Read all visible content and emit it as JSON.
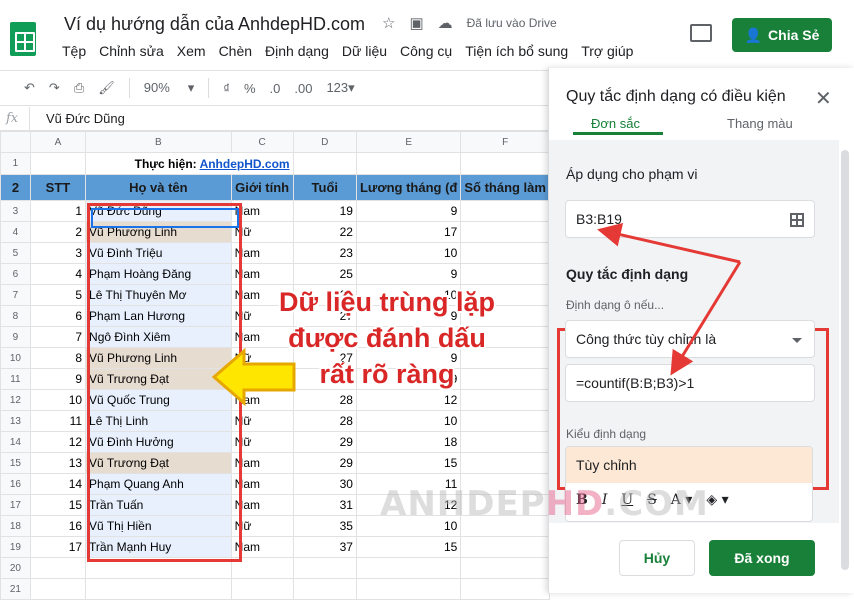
{
  "app": {
    "doc_title": "Ví dụ hướng dẫn của AnhdepHD.com",
    "saved_status": "Đã lưu vào Drive",
    "share_label": "Chia Sẻ",
    "menu": [
      "Tệp",
      "Chỉnh sửa",
      "Xem",
      "Chèn",
      "Định dạng",
      "Dữ liệu",
      "Công cụ",
      "Tiện ích bổ sung",
      "Trợ giúp"
    ]
  },
  "toolbar": {
    "zoom": "90%",
    "currency": "₫",
    "percent": "%",
    "decrease_decimal": ".0",
    "increase_decimal": ".00",
    "more_formats": "123"
  },
  "formula_bar": {
    "fx": "fx",
    "value": "Vũ Đức Dũng"
  },
  "sheet": {
    "col_headers": [
      "A",
      "B",
      "C",
      "D",
      "E",
      "F"
    ],
    "performed_by_label": "Thực hiện:",
    "performed_by_link": "AnhdepHD.com",
    "headers": [
      "STT",
      "Họ và tên",
      "Giới tính",
      "Tuổi",
      "Lương tháng (đ",
      "Số tháng làm"
    ],
    "rows": [
      {
        "row": "3",
        "stt": "1",
        "name": "Vũ Đức Dũng",
        "gender": "Nam",
        "age": "19",
        "salary": "9"
      },
      {
        "row": "4",
        "stt": "2",
        "name": "Vũ Phương Linh",
        "gender": "Nữ",
        "age": "22",
        "salary": "17"
      },
      {
        "row": "5",
        "stt": "3",
        "name": "Vũ Đình Triệu",
        "gender": "Nam",
        "age": "23",
        "salary": "10"
      },
      {
        "row": "6",
        "stt": "4",
        "name": "Phạm Hoàng Đăng",
        "gender": "Nam",
        "age": "25",
        "salary": "9"
      },
      {
        "row": "7",
        "stt": "5",
        "name": "Lê Thị Thuyên Mơ",
        "gender": "Nam",
        "age": "26",
        "salary": "10"
      },
      {
        "row": "8",
        "stt": "6",
        "name": "Phạm Lan Hương",
        "gender": "Nữ",
        "age": "27",
        "salary": "9"
      },
      {
        "row": "9",
        "stt": "7",
        "name": "Ngô Đình Xiêm",
        "gender": "Nam",
        "age": "27",
        "salary": "9"
      },
      {
        "row": "10",
        "stt": "8",
        "name": "Vũ Phương Linh",
        "gender": "Nữ",
        "age": "27",
        "salary": "9"
      },
      {
        "row": "11",
        "stt": "9",
        "name": "Vũ Trương Đạt",
        "gender": "Nam",
        "age": "27",
        "salary": "9"
      },
      {
        "row": "12",
        "stt": "10",
        "name": "Vũ Quốc Trung",
        "gender": "Nam",
        "age": "28",
        "salary": "12"
      },
      {
        "row": "13",
        "stt": "11",
        "name": "Lê Thị Linh",
        "gender": "Nữ",
        "age": "28",
        "salary": "10"
      },
      {
        "row": "14",
        "stt": "12",
        "name": "Vũ Đình Hưởng",
        "gender": "Nữ",
        "age": "29",
        "salary": "18"
      },
      {
        "row": "15",
        "stt": "13",
        "name": "Vũ Trương Đạt",
        "gender": "Nam",
        "age": "29",
        "salary": "15"
      },
      {
        "row": "16",
        "stt": "14",
        "name": "Phạm Quang Anh",
        "gender": "Nam",
        "age": "30",
        "salary": "11"
      },
      {
        "row": "17",
        "stt": "15",
        "name": "Trần Tuấn",
        "gender": "Nam",
        "age": "31",
        "salary": "12"
      },
      {
        "row": "18",
        "stt": "16",
        "name": "Vũ Thị Hiền",
        "gender": "Nữ",
        "age": "35",
        "salary": "10"
      },
      {
        "row": "19",
        "stt": "17",
        "name": "Trần Mạnh Huy",
        "gender": "Nam",
        "age": "37",
        "salary": "15"
      }
    ],
    "duplicate_rows": [
      4,
      10,
      11,
      15
    ],
    "empty_rows": [
      "20",
      "21"
    ]
  },
  "annotation": {
    "line1": "Dữ liệu trùng lặp",
    "line2": "được đánh dấu",
    "line3": "rất rõ ràng"
  },
  "panel": {
    "title": "Quy tắc định dạng có điều kiện",
    "tab_single": "Đơn sắc",
    "tab_scale": "Thang màu",
    "apply_range_label": "Áp dụng cho phạm vi",
    "range_value": "B3:B19",
    "rules_label": "Quy tắc định dạng",
    "condition_label": "Định dạng ô nếu...",
    "condition_value": "Công thức tùy chỉnh là",
    "formula_value": "=countif(B:B;B3)>1",
    "style_label": "Kiểu định dạng",
    "style_value": "Tùy chỉnh",
    "cancel_label": "Hủy",
    "done_label": "Đã xong",
    "accent_color": "#188038",
    "duplicate_fill": "#e7dcd0"
  },
  "watermark": {
    "part1": "ANHDEP",
    "part2": "HD",
    "part3": ".COM"
  }
}
